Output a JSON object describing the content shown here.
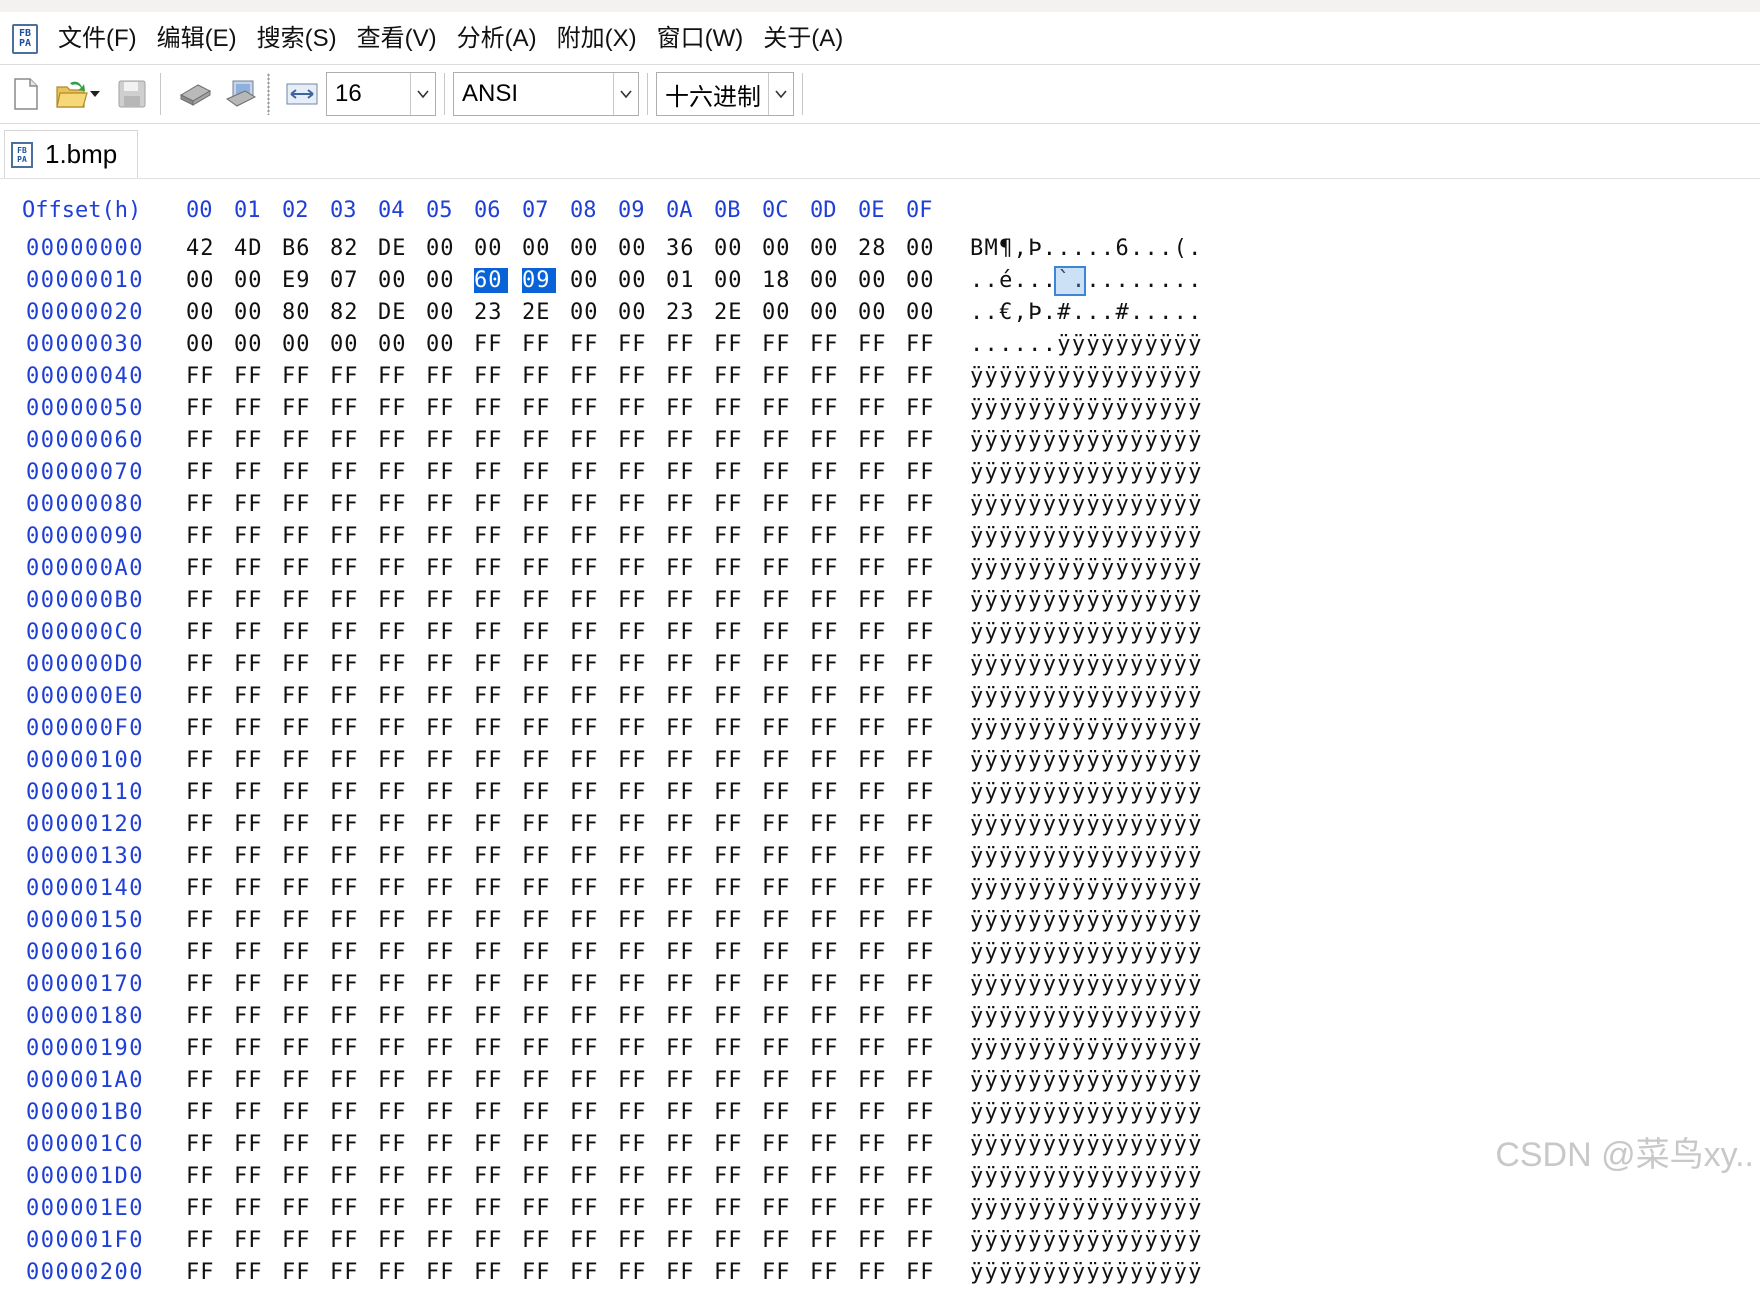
{
  "menubar": {
    "items": [
      "文件(F)",
      "编辑(E)",
      "搜索(S)",
      "查看(V)",
      "分析(A)",
      "附加(X)",
      "窗口(W)",
      "关于(A)"
    ]
  },
  "toolbar": {
    "bytes_per_row": "16",
    "encoding": "ANSI",
    "display_mode": "十六进制"
  },
  "tab": {
    "label": "1.bmp"
  },
  "hex": {
    "header_offset": "Offset(h)",
    "columns": [
      "00",
      "01",
      "02",
      "03",
      "04",
      "05",
      "06",
      "07",
      "08",
      "09",
      "0A",
      "0B",
      "0C",
      "0D",
      "0E",
      "0F"
    ],
    "selected": [
      22,
      23
    ],
    "rows": [
      {
        "offset": "00000000",
        "bytes": [
          "42",
          "4D",
          "B6",
          "82",
          "DE",
          "00",
          "00",
          "00",
          "00",
          "00",
          "36",
          "00",
          "00",
          "00",
          "28",
          "00"
        ],
        "ascii": "BM¶,Þ.....6...(."
      },
      {
        "offset": "00000010",
        "bytes": [
          "00",
          "00",
          "E9",
          "07",
          "00",
          "00",
          "60",
          "09",
          "00",
          "00",
          "01",
          "00",
          "18",
          "00",
          "00",
          "00"
        ],
        "ascii": "..é...`........."
      },
      {
        "offset": "00000020",
        "bytes": [
          "00",
          "00",
          "80",
          "82",
          "DE",
          "00",
          "23",
          "2E",
          "00",
          "00",
          "23",
          "2E",
          "00",
          "00",
          "00",
          "00"
        ],
        "ascii": "..€,Þ.#...#....."
      },
      {
        "offset": "00000030",
        "bytes": [
          "00",
          "00",
          "00",
          "00",
          "00",
          "00",
          "FF",
          "FF",
          "FF",
          "FF",
          "FF",
          "FF",
          "FF",
          "FF",
          "FF",
          "FF"
        ],
        "ascii": "......ÿÿÿÿÿÿÿÿÿÿ"
      },
      {
        "offset": "00000040",
        "bytes": [
          "FF",
          "FF",
          "FF",
          "FF",
          "FF",
          "FF",
          "FF",
          "FF",
          "FF",
          "FF",
          "FF",
          "FF",
          "FF",
          "FF",
          "FF",
          "FF"
        ],
        "ascii": "ÿÿÿÿÿÿÿÿÿÿÿÿÿÿÿÿ"
      },
      {
        "offset": "00000050",
        "bytes": [
          "FF",
          "FF",
          "FF",
          "FF",
          "FF",
          "FF",
          "FF",
          "FF",
          "FF",
          "FF",
          "FF",
          "FF",
          "FF",
          "FF",
          "FF",
          "FF"
        ],
        "ascii": "ÿÿÿÿÿÿÿÿÿÿÿÿÿÿÿÿ"
      },
      {
        "offset": "00000060",
        "bytes": [
          "FF",
          "FF",
          "FF",
          "FF",
          "FF",
          "FF",
          "FF",
          "FF",
          "FF",
          "FF",
          "FF",
          "FF",
          "FF",
          "FF",
          "FF",
          "FF"
        ],
        "ascii": "ÿÿÿÿÿÿÿÿÿÿÿÿÿÿÿÿ"
      },
      {
        "offset": "00000070",
        "bytes": [
          "FF",
          "FF",
          "FF",
          "FF",
          "FF",
          "FF",
          "FF",
          "FF",
          "FF",
          "FF",
          "FF",
          "FF",
          "FF",
          "FF",
          "FF",
          "FF"
        ],
        "ascii": "ÿÿÿÿÿÿÿÿÿÿÿÿÿÿÿÿ"
      },
      {
        "offset": "00000080",
        "bytes": [
          "FF",
          "FF",
          "FF",
          "FF",
          "FF",
          "FF",
          "FF",
          "FF",
          "FF",
          "FF",
          "FF",
          "FF",
          "FF",
          "FF",
          "FF",
          "FF"
        ],
        "ascii": "ÿÿÿÿÿÿÿÿÿÿÿÿÿÿÿÿ"
      },
      {
        "offset": "00000090",
        "bytes": [
          "FF",
          "FF",
          "FF",
          "FF",
          "FF",
          "FF",
          "FF",
          "FF",
          "FF",
          "FF",
          "FF",
          "FF",
          "FF",
          "FF",
          "FF",
          "FF"
        ],
        "ascii": "ÿÿÿÿÿÿÿÿÿÿÿÿÿÿÿÿ"
      },
      {
        "offset": "000000A0",
        "bytes": [
          "FF",
          "FF",
          "FF",
          "FF",
          "FF",
          "FF",
          "FF",
          "FF",
          "FF",
          "FF",
          "FF",
          "FF",
          "FF",
          "FF",
          "FF",
          "FF"
        ],
        "ascii": "ÿÿÿÿÿÿÿÿÿÿÿÿÿÿÿÿ"
      },
      {
        "offset": "000000B0",
        "bytes": [
          "FF",
          "FF",
          "FF",
          "FF",
          "FF",
          "FF",
          "FF",
          "FF",
          "FF",
          "FF",
          "FF",
          "FF",
          "FF",
          "FF",
          "FF",
          "FF"
        ],
        "ascii": "ÿÿÿÿÿÿÿÿÿÿÿÿÿÿÿÿ"
      },
      {
        "offset": "000000C0",
        "bytes": [
          "FF",
          "FF",
          "FF",
          "FF",
          "FF",
          "FF",
          "FF",
          "FF",
          "FF",
          "FF",
          "FF",
          "FF",
          "FF",
          "FF",
          "FF",
          "FF"
        ],
        "ascii": "ÿÿÿÿÿÿÿÿÿÿÿÿÿÿÿÿ"
      },
      {
        "offset": "000000D0",
        "bytes": [
          "FF",
          "FF",
          "FF",
          "FF",
          "FF",
          "FF",
          "FF",
          "FF",
          "FF",
          "FF",
          "FF",
          "FF",
          "FF",
          "FF",
          "FF",
          "FF"
        ],
        "ascii": "ÿÿÿÿÿÿÿÿÿÿÿÿÿÿÿÿ"
      },
      {
        "offset": "000000E0",
        "bytes": [
          "FF",
          "FF",
          "FF",
          "FF",
          "FF",
          "FF",
          "FF",
          "FF",
          "FF",
          "FF",
          "FF",
          "FF",
          "FF",
          "FF",
          "FF",
          "FF"
        ],
        "ascii": "ÿÿÿÿÿÿÿÿÿÿÿÿÿÿÿÿ"
      },
      {
        "offset": "000000F0",
        "bytes": [
          "FF",
          "FF",
          "FF",
          "FF",
          "FF",
          "FF",
          "FF",
          "FF",
          "FF",
          "FF",
          "FF",
          "FF",
          "FF",
          "FF",
          "FF",
          "FF"
        ],
        "ascii": "ÿÿÿÿÿÿÿÿÿÿÿÿÿÿÿÿ"
      },
      {
        "offset": "00000100",
        "bytes": [
          "FF",
          "FF",
          "FF",
          "FF",
          "FF",
          "FF",
          "FF",
          "FF",
          "FF",
          "FF",
          "FF",
          "FF",
          "FF",
          "FF",
          "FF",
          "FF"
        ],
        "ascii": "ÿÿÿÿÿÿÿÿÿÿÿÿÿÿÿÿ"
      },
      {
        "offset": "00000110",
        "bytes": [
          "FF",
          "FF",
          "FF",
          "FF",
          "FF",
          "FF",
          "FF",
          "FF",
          "FF",
          "FF",
          "FF",
          "FF",
          "FF",
          "FF",
          "FF",
          "FF"
        ],
        "ascii": "ÿÿÿÿÿÿÿÿÿÿÿÿÿÿÿÿ"
      },
      {
        "offset": "00000120",
        "bytes": [
          "FF",
          "FF",
          "FF",
          "FF",
          "FF",
          "FF",
          "FF",
          "FF",
          "FF",
          "FF",
          "FF",
          "FF",
          "FF",
          "FF",
          "FF",
          "FF"
        ],
        "ascii": "ÿÿÿÿÿÿÿÿÿÿÿÿÿÿÿÿ"
      },
      {
        "offset": "00000130",
        "bytes": [
          "FF",
          "FF",
          "FF",
          "FF",
          "FF",
          "FF",
          "FF",
          "FF",
          "FF",
          "FF",
          "FF",
          "FF",
          "FF",
          "FF",
          "FF",
          "FF"
        ],
        "ascii": "ÿÿÿÿÿÿÿÿÿÿÿÿÿÿÿÿ"
      },
      {
        "offset": "00000140",
        "bytes": [
          "FF",
          "FF",
          "FF",
          "FF",
          "FF",
          "FF",
          "FF",
          "FF",
          "FF",
          "FF",
          "FF",
          "FF",
          "FF",
          "FF",
          "FF",
          "FF"
        ],
        "ascii": "ÿÿÿÿÿÿÿÿÿÿÿÿÿÿÿÿ"
      },
      {
        "offset": "00000150",
        "bytes": [
          "FF",
          "FF",
          "FF",
          "FF",
          "FF",
          "FF",
          "FF",
          "FF",
          "FF",
          "FF",
          "FF",
          "FF",
          "FF",
          "FF",
          "FF",
          "FF"
        ],
        "ascii": "ÿÿÿÿÿÿÿÿÿÿÿÿÿÿÿÿ"
      },
      {
        "offset": "00000160",
        "bytes": [
          "FF",
          "FF",
          "FF",
          "FF",
          "FF",
          "FF",
          "FF",
          "FF",
          "FF",
          "FF",
          "FF",
          "FF",
          "FF",
          "FF",
          "FF",
          "FF"
        ],
        "ascii": "ÿÿÿÿÿÿÿÿÿÿÿÿÿÿÿÿ"
      },
      {
        "offset": "00000170",
        "bytes": [
          "FF",
          "FF",
          "FF",
          "FF",
          "FF",
          "FF",
          "FF",
          "FF",
          "FF",
          "FF",
          "FF",
          "FF",
          "FF",
          "FF",
          "FF",
          "FF"
        ],
        "ascii": "ÿÿÿÿÿÿÿÿÿÿÿÿÿÿÿÿ"
      },
      {
        "offset": "00000180",
        "bytes": [
          "FF",
          "FF",
          "FF",
          "FF",
          "FF",
          "FF",
          "FF",
          "FF",
          "FF",
          "FF",
          "FF",
          "FF",
          "FF",
          "FF",
          "FF",
          "FF"
        ],
        "ascii": "ÿÿÿÿÿÿÿÿÿÿÿÿÿÿÿÿ"
      },
      {
        "offset": "00000190",
        "bytes": [
          "FF",
          "FF",
          "FF",
          "FF",
          "FF",
          "FF",
          "FF",
          "FF",
          "FF",
          "FF",
          "FF",
          "FF",
          "FF",
          "FF",
          "FF",
          "FF"
        ],
        "ascii": "ÿÿÿÿÿÿÿÿÿÿÿÿÿÿÿÿ"
      },
      {
        "offset": "000001A0",
        "bytes": [
          "FF",
          "FF",
          "FF",
          "FF",
          "FF",
          "FF",
          "FF",
          "FF",
          "FF",
          "FF",
          "FF",
          "FF",
          "FF",
          "FF",
          "FF",
          "FF"
        ],
        "ascii": "ÿÿÿÿÿÿÿÿÿÿÿÿÿÿÿÿ"
      },
      {
        "offset": "000001B0",
        "bytes": [
          "FF",
          "FF",
          "FF",
          "FF",
          "FF",
          "FF",
          "FF",
          "FF",
          "FF",
          "FF",
          "FF",
          "FF",
          "FF",
          "FF",
          "FF",
          "FF"
        ],
        "ascii": "ÿÿÿÿÿÿÿÿÿÿÿÿÿÿÿÿ"
      },
      {
        "offset": "000001C0",
        "bytes": [
          "FF",
          "FF",
          "FF",
          "FF",
          "FF",
          "FF",
          "FF",
          "FF",
          "FF",
          "FF",
          "FF",
          "FF",
          "FF",
          "FF",
          "FF",
          "FF"
        ],
        "ascii": "ÿÿÿÿÿÿÿÿÿÿÿÿÿÿÿÿ"
      },
      {
        "offset": "000001D0",
        "bytes": [
          "FF",
          "FF",
          "FF",
          "FF",
          "FF",
          "FF",
          "FF",
          "FF",
          "FF",
          "FF",
          "FF",
          "FF",
          "FF",
          "FF",
          "FF",
          "FF"
        ],
        "ascii": "ÿÿÿÿÿÿÿÿÿÿÿÿÿÿÿÿ"
      },
      {
        "offset": "000001E0",
        "bytes": [
          "FF",
          "FF",
          "FF",
          "FF",
          "FF",
          "FF",
          "FF",
          "FF",
          "FF",
          "FF",
          "FF",
          "FF",
          "FF",
          "FF",
          "FF",
          "FF"
        ],
        "ascii": "ÿÿÿÿÿÿÿÿÿÿÿÿÿÿÿÿ"
      },
      {
        "offset": "000001F0",
        "bytes": [
          "FF",
          "FF",
          "FF",
          "FF",
          "FF",
          "FF",
          "FF",
          "FF",
          "FF",
          "FF",
          "FF",
          "FF",
          "FF",
          "FF",
          "FF",
          "FF"
        ],
        "ascii": "ÿÿÿÿÿÿÿÿÿÿÿÿÿÿÿÿ"
      },
      {
        "offset": "00000200",
        "bytes": [
          "FF",
          "FF",
          "FF",
          "FF",
          "FF",
          "FF",
          "FF",
          "FF",
          "FF",
          "FF",
          "FF",
          "FF",
          "FF",
          "FF",
          "FF",
          "FF"
        ],
        "ascii": "ÿÿÿÿÿÿÿÿÿÿÿÿÿÿÿÿ"
      }
    ]
  },
  "watermark": "CSDN @菜鸟xy.."
}
